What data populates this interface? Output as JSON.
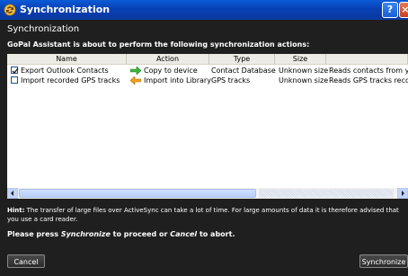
{
  "window": {
    "title": "Synchronization"
  },
  "dialog": {
    "heading": "Synchronization",
    "intro": "GoPal Assistant is about to perform the following synchronization actions:"
  },
  "table": {
    "columns": [
      "Name",
      "Action",
      "Type",
      "Size",
      ""
    ],
    "rows": [
      {
        "checked": true,
        "name": "Export Outlook Contacts",
        "arrow": "green-right-arrow",
        "action": "Copy to device",
        "type": "Contact Database",
        "size": "Unknown size",
        "description": "Reads contacts from yo"
      },
      {
        "checked": false,
        "name": "Import recorded GPS tracks",
        "arrow": "orange-left-arrow",
        "action": "Import into Library",
        "type": "GPS tracks",
        "size": "Unknown size",
        "description": "Reads GPS tracks recor"
      }
    ]
  },
  "hint": {
    "label": "Hint:",
    "text": " The transfer of large files over ActiveSync can take a lot of time. For large amounts of data it is therefore advised that you use a card reader."
  },
  "prompt": {
    "pre": "Please press ",
    "sync_word": "Synchronize",
    "mid": " to proceed or ",
    "cancel_word": "Cancel",
    "post": " to abort."
  },
  "buttons": {
    "cancel": "Cancel",
    "synchronize": "Synchronize"
  },
  "colors": {
    "titlebar": "#0a4fc8",
    "background": "#1f1f1f",
    "accent_green": "#3cb83c",
    "accent_orange": "#f0a020"
  }
}
